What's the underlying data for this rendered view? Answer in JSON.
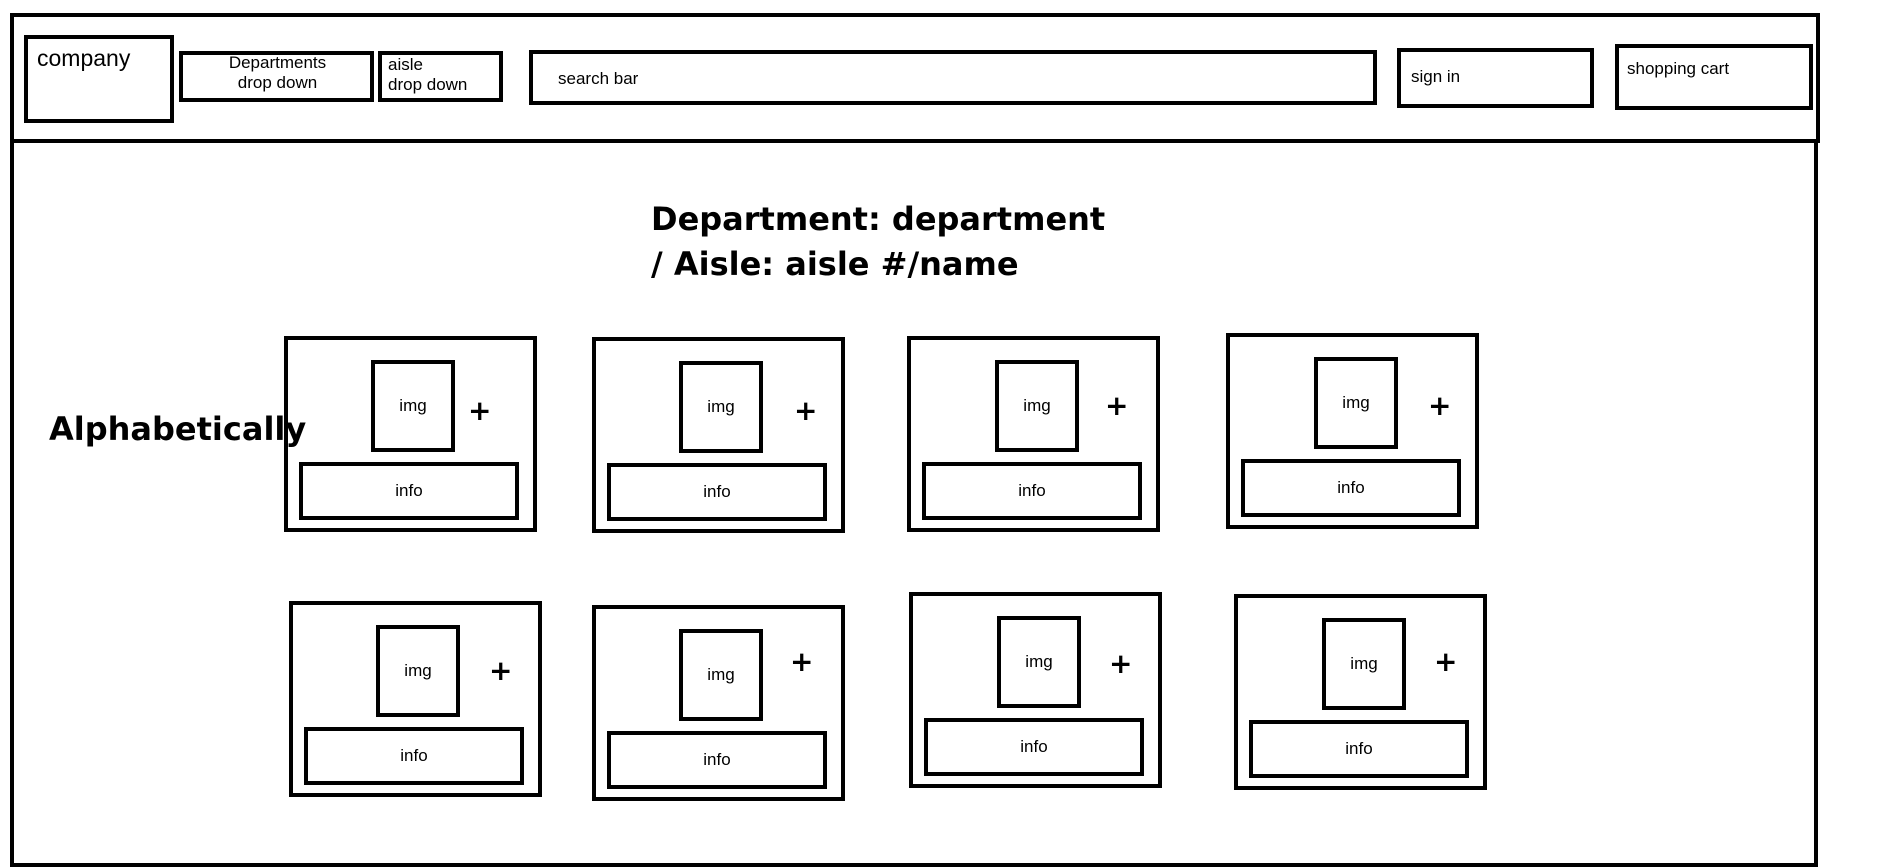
{
  "header": {
    "company": "company",
    "departments_dropdown": "Departments\ndrop down",
    "aisle_dropdown": "aisle\ndrop down",
    "search_placeholder": "search bar",
    "sign_in": "sign in",
    "shopping_cart": "shopping cart"
  },
  "main": {
    "title_line1": "Department: department",
    "title_line2": "/ Aisle: aisle #/name",
    "sort_label": "Alphabetically",
    "products": [
      {
        "img": "img",
        "add": "+",
        "info": "info"
      },
      {
        "img": "img",
        "add": "+",
        "info": "info"
      },
      {
        "img": "img",
        "add": "+",
        "info": "info"
      },
      {
        "img": "img",
        "add": "+",
        "info": "info"
      },
      {
        "img": "img",
        "add": "+",
        "info": "info"
      },
      {
        "img": "img",
        "add": "+",
        "info": "info"
      },
      {
        "img": "img",
        "add": "+",
        "info": "info"
      },
      {
        "img": "img",
        "add": "+",
        "info": "info"
      }
    ]
  }
}
